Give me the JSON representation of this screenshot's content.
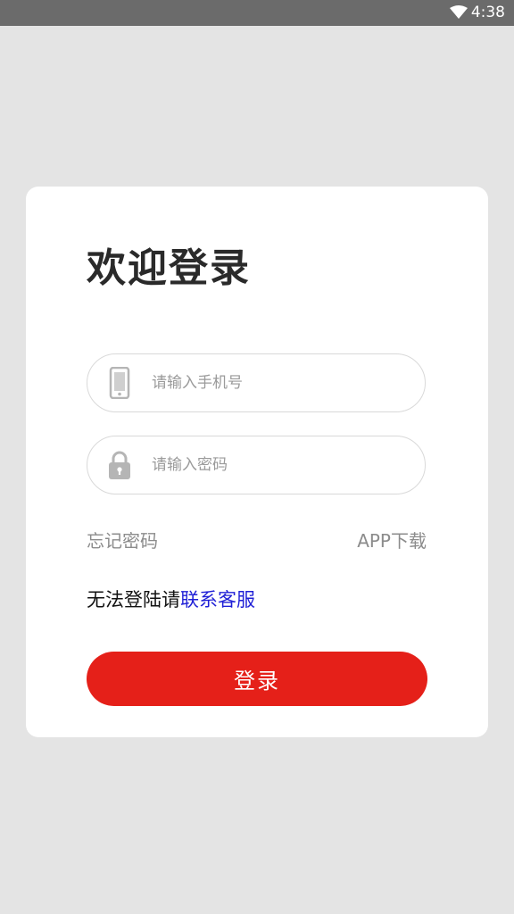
{
  "status_bar": {
    "time": "4:38",
    "wifi_icon": "wifi-icon"
  },
  "login": {
    "title": "欢迎登录",
    "phone": {
      "placeholder": "请输入手机号",
      "value": "",
      "icon": "phone-icon"
    },
    "password": {
      "placeholder": "请输入密码",
      "value": "",
      "icon": "lock-icon"
    },
    "forgot_password": "忘记密码",
    "app_download": "APP下载",
    "help_text": "无法登陆请",
    "contact_link": "联系客服",
    "submit_label": "登录"
  },
  "colors": {
    "background": "#e4e4e4",
    "status_bar": "#6b6b6b",
    "card": "#ffffff",
    "primary_button": "#e52019",
    "link_blue": "#1f1fd6",
    "muted_text": "#8c8c8c"
  }
}
